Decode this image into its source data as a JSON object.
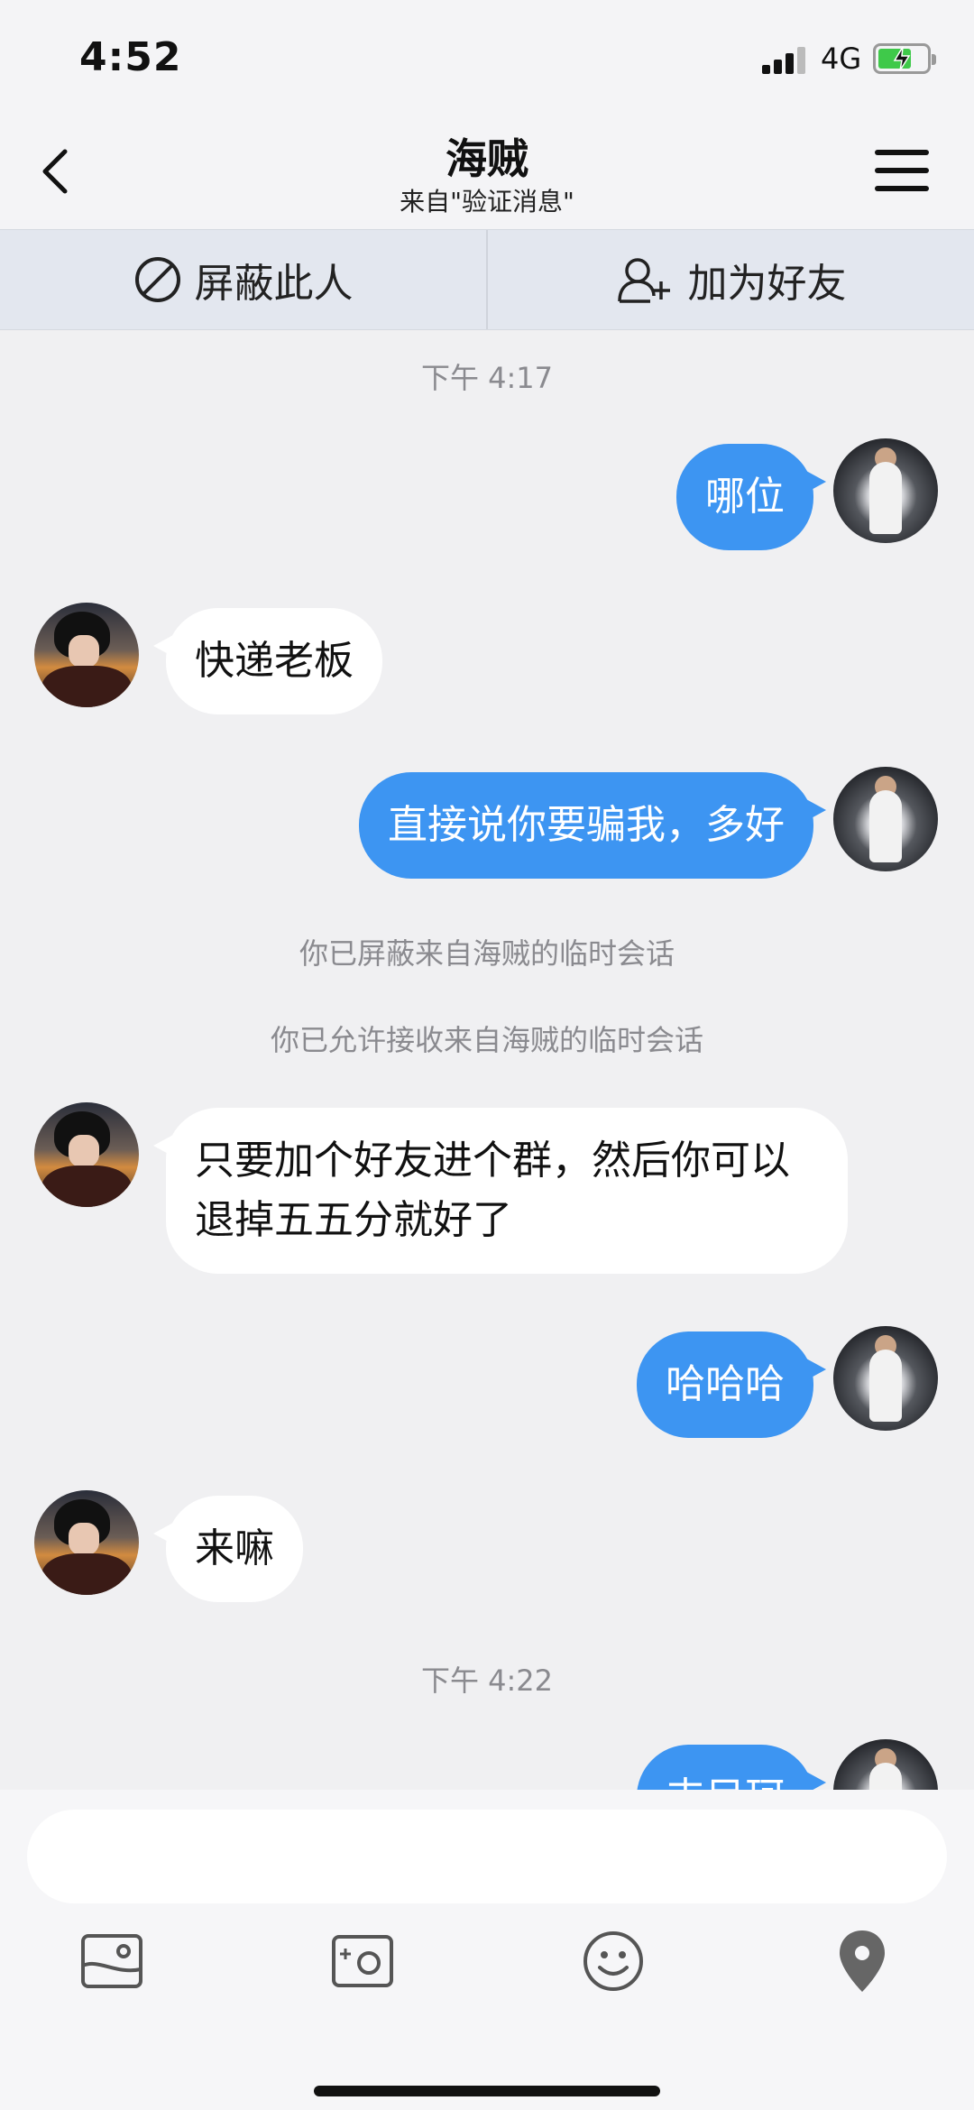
{
  "status": {
    "time": "4:52",
    "network": "4G"
  },
  "header": {
    "title": "海贼",
    "subtitle": "来自\"验证消息\""
  },
  "actions": {
    "block": "屏蔽此人",
    "add_friend": "加为好友"
  },
  "messages": [
    {
      "type": "timestamp",
      "text": "下午 4:17"
    },
    {
      "type": "me",
      "text": "哪位"
    },
    {
      "type": "other",
      "text": "快递老板"
    },
    {
      "type": "me",
      "text": "直接说你要骗我，多好"
    },
    {
      "type": "system",
      "text": "你已屏蔽来自海贼的临时会话"
    },
    {
      "type": "system",
      "text": "你已允许接收来自海贼的临时会话"
    },
    {
      "type": "other",
      "text": "只要加个好友进个群，然后你可以退掉五五分就好了"
    },
    {
      "type": "me",
      "text": "哈哈哈"
    },
    {
      "type": "other",
      "text": "来嘛"
    },
    {
      "type": "timestamp",
      "text": "下午 4:22"
    },
    {
      "type": "me",
      "text": "丰目珂"
    }
  ],
  "input": {
    "placeholder": ""
  },
  "toolbar": [
    "image-icon",
    "camera-icon",
    "emoji-icon",
    "location-icon"
  ],
  "colors": {
    "accent": "#3d95f2",
    "background": "#f0f0f2",
    "battery": "#3fc94a"
  }
}
